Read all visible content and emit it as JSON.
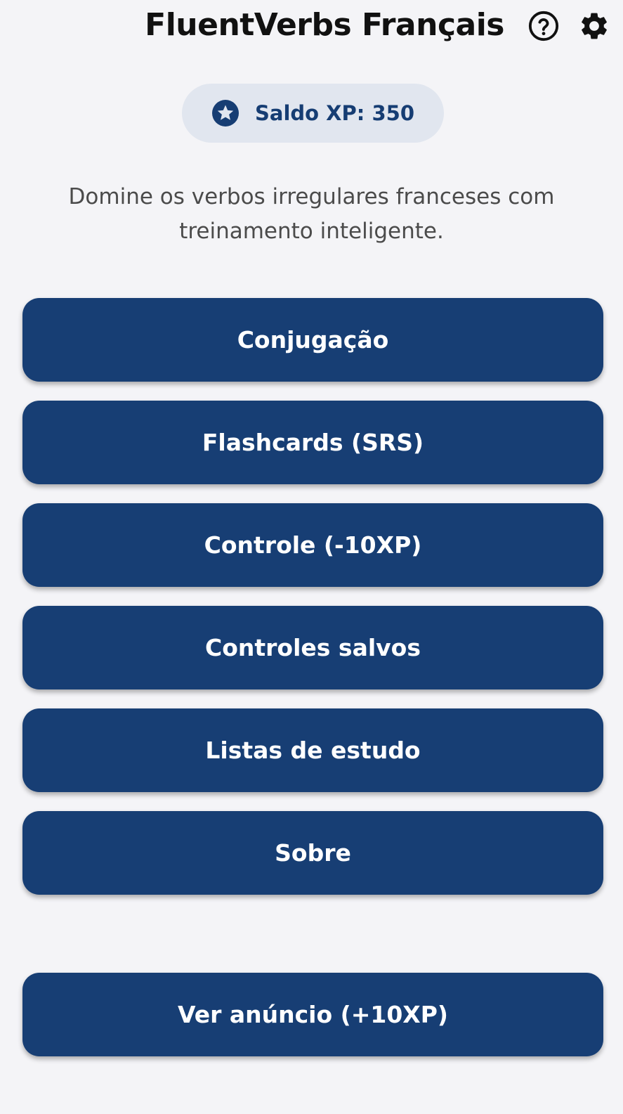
{
  "header": {
    "title": "FluentVerbs Français",
    "help_icon": "help-circle-icon",
    "settings_icon": "gear-icon"
  },
  "xp": {
    "icon": "star-circle-icon",
    "label": "Saldo XP: 350"
  },
  "subtitle": "Domine os verbos irregulares franceses com treinamento inteligente.",
  "menu": {
    "items": [
      {
        "label": "Conjugação"
      },
      {
        "label": "Flashcards (SRS)"
      },
      {
        "label": "Controle (-10XP)"
      },
      {
        "label": "Controles salvos"
      },
      {
        "label": "Listas de estudo"
      },
      {
        "label": "Sobre"
      }
    ]
  },
  "ad_button": {
    "label": "Ver anúncio (+10XP)"
  },
  "colors": {
    "primary": "#173e74",
    "background": "#f4f4f7",
    "badge_background": "#e1e6ef",
    "badge_text": "#163d73"
  }
}
